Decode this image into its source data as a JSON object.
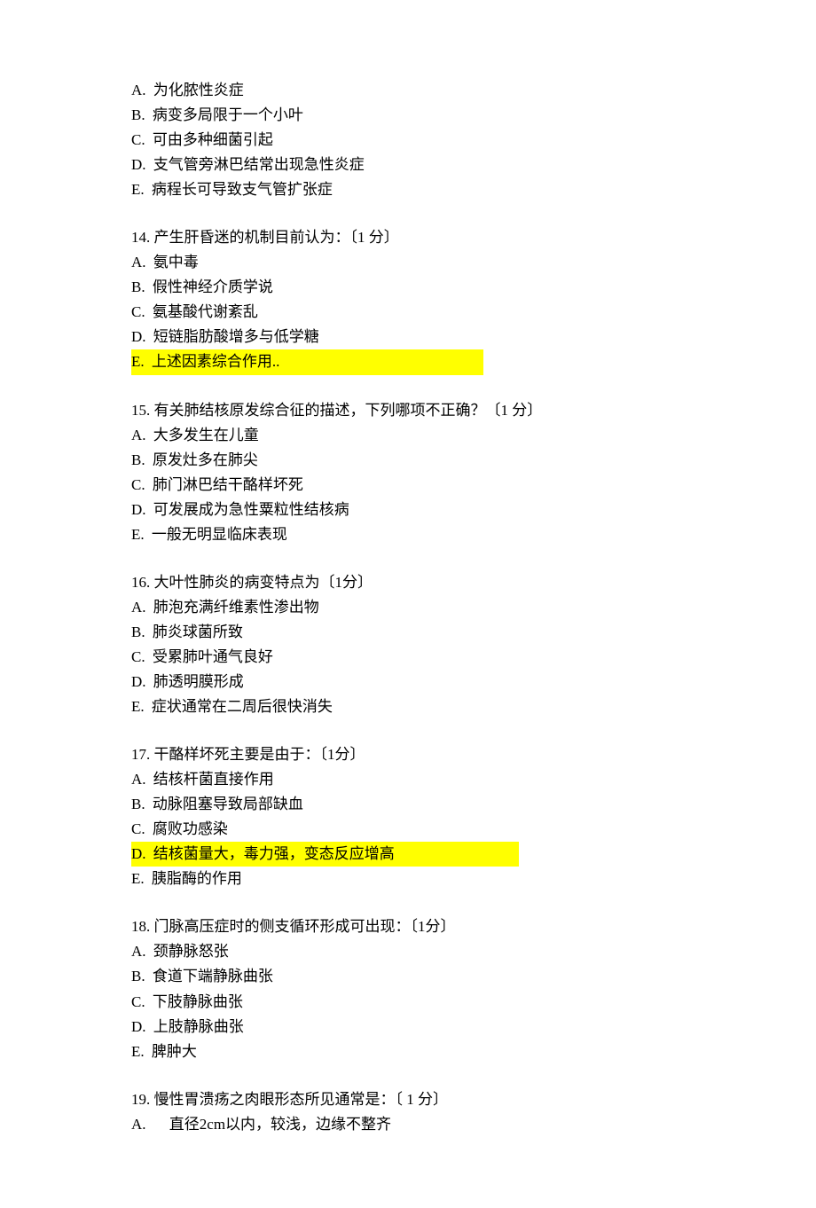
{
  "q13": {
    "options": {
      "A": "为化脓性炎症",
      "B": "病变多局限于一个小叶",
      "C": "可由多种细菌引起",
      "D": "支气管旁淋巴结常出现急性炎症",
      "E": "病程长可导致支气管扩张症"
    }
  },
  "q14": {
    "stem": "14. 产生肝昏迷的机制目前认为：〔1 分〕",
    "options": {
      "A": "氨中毒",
      "B": "假性神经介质学说",
      "C": "氨基酸代谢紊乱",
      "D": "短链脂肪酸增多与低学糖",
      "E": "上述因素综合作用.."
    }
  },
  "q15": {
    "stem": "15. 有关肺结核原发综合征的描述，下列哪项不正确？〔1 分〕",
    "options": {
      "A": "大多发生在儿童",
      "B": "原发灶多在肺尖",
      "C": "肺门淋巴结干酪样坏死",
      "D": "可发展成为急性粟粒性结核病",
      "E": "一般无明显临床表现"
    }
  },
  "q16": {
    "stem": "16. 大叶性肺炎的病变特点为〔1分〕",
    "options": {
      "A": "肺泡充满纤维素性渗出物",
      "B": "肺炎球菌所致",
      "C": "受累肺叶通气良好",
      "D": "肺透明膜形成",
      "E": "症状通常在二周后很快消失"
    }
  },
  "q17": {
    "stem": "17. 干酪样坏死主要是由于：〔1分〕",
    "options": {
      "A": "结核杆菌直接作用",
      "B": "动脉阻塞导致局部缺血",
      "C": "腐败功感染",
      "D": "结核菌量大，毒力强，变态反应增高",
      "E": "胰脂酶的作用"
    }
  },
  "q18": {
    "stem": "18. 门脉高压症时的侧支循环形成可出现：〔1分〕",
    "options": {
      "A": "颈静脉怒张",
      "B": "食道下端静脉曲张",
      "C": "下肢静脉曲张",
      "D": "上肢静脉曲张",
      "E": "脾肿大"
    }
  },
  "q19": {
    "stem": "19. 慢性胃溃疡之肉眼形态所见通常是：〔 1 分〕",
    "options": {
      "A": "  直径2cm以内，较浅，边缘不整齐"
    }
  },
  "labels": {
    "A": "A.",
    "B": "B.",
    "C": "C.",
    "D": "D.",
    "E": "E."
  }
}
